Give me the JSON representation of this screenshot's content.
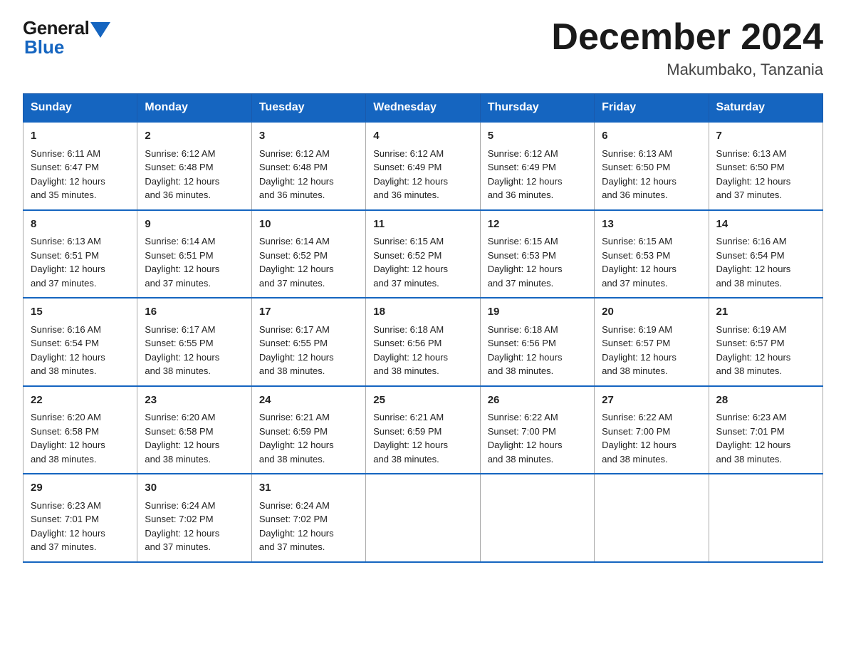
{
  "header": {
    "logo_general": "General",
    "logo_blue": "Blue",
    "month_title": "December 2024",
    "location": "Makumbako, Tanzania"
  },
  "days_of_week": [
    "Sunday",
    "Monday",
    "Tuesday",
    "Wednesday",
    "Thursday",
    "Friday",
    "Saturday"
  ],
  "weeks": [
    [
      {
        "day": "1",
        "sunrise": "6:11 AM",
        "sunset": "6:47 PM",
        "daylight": "12 hours and 35 minutes."
      },
      {
        "day": "2",
        "sunrise": "6:12 AM",
        "sunset": "6:48 PM",
        "daylight": "12 hours and 36 minutes."
      },
      {
        "day": "3",
        "sunrise": "6:12 AM",
        "sunset": "6:48 PM",
        "daylight": "12 hours and 36 minutes."
      },
      {
        "day": "4",
        "sunrise": "6:12 AM",
        "sunset": "6:49 PM",
        "daylight": "12 hours and 36 minutes."
      },
      {
        "day": "5",
        "sunrise": "6:12 AM",
        "sunset": "6:49 PM",
        "daylight": "12 hours and 36 minutes."
      },
      {
        "day": "6",
        "sunrise": "6:13 AM",
        "sunset": "6:50 PM",
        "daylight": "12 hours and 36 minutes."
      },
      {
        "day": "7",
        "sunrise": "6:13 AM",
        "sunset": "6:50 PM",
        "daylight": "12 hours and 37 minutes."
      }
    ],
    [
      {
        "day": "8",
        "sunrise": "6:13 AM",
        "sunset": "6:51 PM",
        "daylight": "12 hours and 37 minutes."
      },
      {
        "day": "9",
        "sunrise": "6:14 AM",
        "sunset": "6:51 PM",
        "daylight": "12 hours and 37 minutes."
      },
      {
        "day": "10",
        "sunrise": "6:14 AM",
        "sunset": "6:52 PM",
        "daylight": "12 hours and 37 minutes."
      },
      {
        "day": "11",
        "sunrise": "6:15 AM",
        "sunset": "6:52 PM",
        "daylight": "12 hours and 37 minutes."
      },
      {
        "day": "12",
        "sunrise": "6:15 AM",
        "sunset": "6:53 PM",
        "daylight": "12 hours and 37 minutes."
      },
      {
        "day": "13",
        "sunrise": "6:15 AM",
        "sunset": "6:53 PM",
        "daylight": "12 hours and 37 minutes."
      },
      {
        "day": "14",
        "sunrise": "6:16 AM",
        "sunset": "6:54 PM",
        "daylight": "12 hours and 38 minutes."
      }
    ],
    [
      {
        "day": "15",
        "sunrise": "6:16 AM",
        "sunset": "6:54 PM",
        "daylight": "12 hours and 38 minutes."
      },
      {
        "day": "16",
        "sunrise": "6:17 AM",
        "sunset": "6:55 PM",
        "daylight": "12 hours and 38 minutes."
      },
      {
        "day": "17",
        "sunrise": "6:17 AM",
        "sunset": "6:55 PM",
        "daylight": "12 hours and 38 minutes."
      },
      {
        "day": "18",
        "sunrise": "6:18 AM",
        "sunset": "6:56 PM",
        "daylight": "12 hours and 38 minutes."
      },
      {
        "day": "19",
        "sunrise": "6:18 AM",
        "sunset": "6:56 PM",
        "daylight": "12 hours and 38 minutes."
      },
      {
        "day": "20",
        "sunrise": "6:19 AM",
        "sunset": "6:57 PM",
        "daylight": "12 hours and 38 minutes."
      },
      {
        "day": "21",
        "sunrise": "6:19 AM",
        "sunset": "6:57 PM",
        "daylight": "12 hours and 38 minutes."
      }
    ],
    [
      {
        "day": "22",
        "sunrise": "6:20 AM",
        "sunset": "6:58 PM",
        "daylight": "12 hours and 38 minutes."
      },
      {
        "day": "23",
        "sunrise": "6:20 AM",
        "sunset": "6:58 PM",
        "daylight": "12 hours and 38 minutes."
      },
      {
        "day": "24",
        "sunrise": "6:21 AM",
        "sunset": "6:59 PM",
        "daylight": "12 hours and 38 minutes."
      },
      {
        "day": "25",
        "sunrise": "6:21 AM",
        "sunset": "6:59 PM",
        "daylight": "12 hours and 38 minutes."
      },
      {
        "day": "26",
        "sunrise": "6:22 AM",
        "sunset": "7:00 PM",
        "daylight": "12 hours and 38 minutes."
      },
      {
        "day": "27",
        "sunrise": "6:22 AM",
        "sunset": "7:00 PM",
        "daylight": "12 hours and 38 minutes."
      },
      {
        "day": "28",
        "sunrise": "6:23 AM",
        "sunset": "7:01 PM",
        "daylight": "12 hours and 38 minutes."
      }
    ],
    [
      {
        "day": "29",
        "sunrise": "6:23 AM",
        "sunset": "7:01 PM",
        "daylight": "12 hours and 37 minutes."
      },
      {
        "day": "30",
        "sunrise": "6:24 AM",
        "sunset": "7:02 PM",
        "daylight": "12 hours and 37 minutes."
      },
      {
        "day": "31",
        "sunrise": "6:24 AM",
        "sunset": "7:02 PM",
        "daylight": "12 hours and 37 minutes."
      },
      null,
      null,
      null,
      null
    ]
  ],
  "labels": {
    "sunrise": "Sunrise:",
    "sunset": "Sunset:",
    "daylight": "Daylight:"
  }
}
